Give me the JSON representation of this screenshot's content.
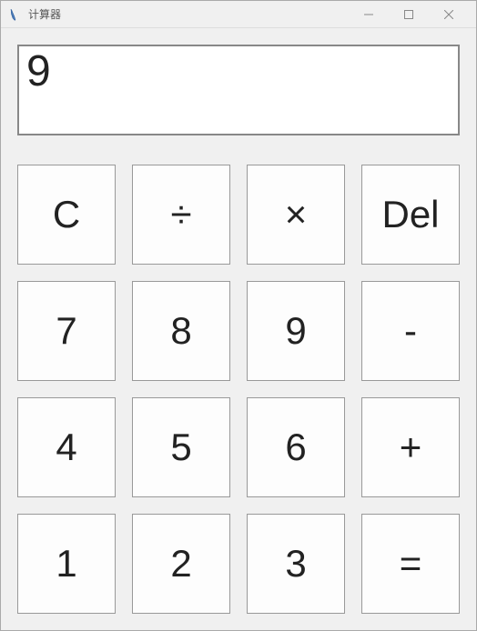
{
  "window": {
    "title": "计算器"
  },
  "display": {
    "value": "9"
  },
  "keys": {
    "r0c0": "C",
    "r0c1": "÷",
    "r0c2": "×",
    "r0c3": "Del",
    "r1c0": "7",
    "r1c1": "8",
    "r1c2": "9",
    "r1c3": "-",
    "r2c0": "4",
    "r2c1": "5",
    "r2c2": "6",
    "r2c3": "+",
    "r3c0": "1",
    "r3c1": "2",
    "r3c2": "3",
    "r3c3": "="
  }
}
